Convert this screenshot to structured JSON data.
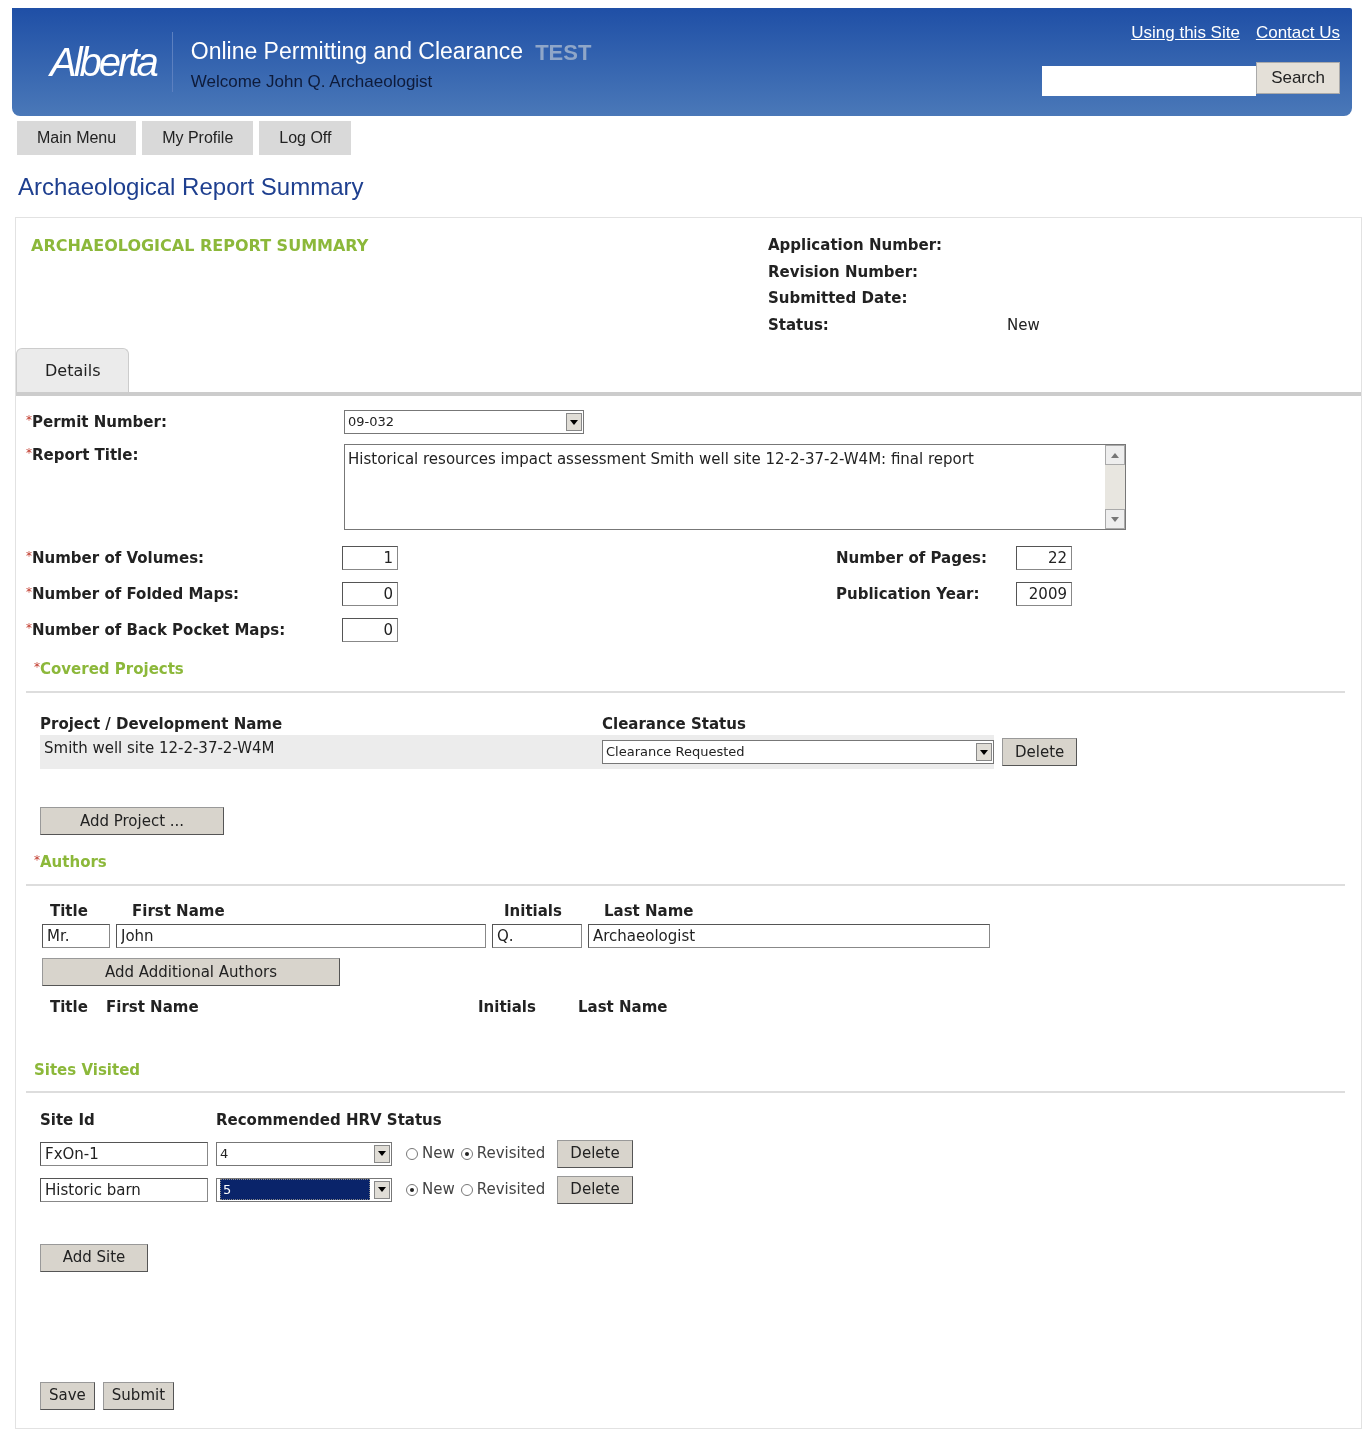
{
  "header": {
    "logo": "Alberta",
    "title": "Online Permitting and Clearance",
    "env": "TEST",
    "welcome": "Welcome John Q. Archaeologist",
    "links": [
      "Using this Site",
      "Contact Us"
    ],
    "search_button": "Search"
  },
  "nav": [
    "Main Menu",
    "My Profile",
    "Log Off"
  ],
  "page_title": "Archaeological Report Summary",
  "summary": {
    "heading": "ARCHAEOLOGICAL REPORT SUMMARY",
    "meta": [
      {
        "label": "Application Number:"
      },
      {
        "label": "Revision Number:"
      },
      {
        "label": "Submitted Date:"
      },
      {
        "label": "Status:",
        "value": "New"
      }
    ]
  },
  "tabs": [
    {
      "label": "Details",
      "selected": true
    }
  ],
  "required_mark": "*",
  "permit": {
    "label": "Permit Number:",
    "value": "09-032",
    "required": true
  },
  "report_title": {
    "label": "Report Title:",
    "value": "Historical resources impact assessment Smith well site 12-2-37-2-W4M: final report",
    "required": true
  },
  "counts_left": [
    {
      "label": "Number of Volumes:",
      "value": "1",
      "required": true
    },
    {
      "label": "Number of Folded Maps:",
      "value": "0",
      "required": true
    },
    {
      "label": "Number of Back Pocket Maps:",
      "value": "0",
      "required": true
    }
  ],
  "counts_right": [
    {
      "label": "Number of Pages:",
      "value": "22",
      "required": false
    },
    {
      "label": "Publication Year:",
      "value": "2009",
      "required": false
    }
  ],
  "covered_projects": {
    "heading": "Covered Projects",
    "required": true,
    "columns": [
      "Project / Development Name",
      "Clearance Status"
    ],
    "rows": [
      {
        "name": "Smith well site 12-2-37-2-W4M",
        "status": "Clearance Requested",
        "delete": "Delete"
      }
    ],
    "add_button": "Add Project ..."
  },
  "authors": {
    "heading": "Authors",
    "required": true,
    "columns": [
      "Title",
      "First Name",
      "Initials",
      "Last Name"
    ],
    "entry": [
      "Mr.",
      "John",
      "Q.",
      "Archaeologist"
    ],
    "add_button": "Add Additional Authors",
    "list_columns": [
      "Title",
      "First Name",
      "Initials",
      "Last Name"
    ]
  },
  "sites": {
    "heading": "Sites Visited",
    "required": false,
    "columns": [
      "Site Id",
      "Recommended HRV Status"
    ],
    "rows": [
      {
        "site_id": "FxOn-1",
        "hrv": "4",
        "focused": false,
        "options": [
          {
            "label": "New",
            "selected": false
          },
          {
            "label": "Revisited",
            "selected": true
          }
        ],
        "delete": "Delete"
      },
      {
        "site_id": "Historic barn",
        "hrv": "5",
        "focused": true,
        "options": [
          {
            "label": "New",
            "selected": true
          },
          {
            "label": "Revisited",
            "selected": false
          }
        ],
        "delete": "Delete"
      }
    ],
    "add_button": "Add Site"
  },
  "footer_buttons": [
    "Save",
    "Submit"
  ]
}
